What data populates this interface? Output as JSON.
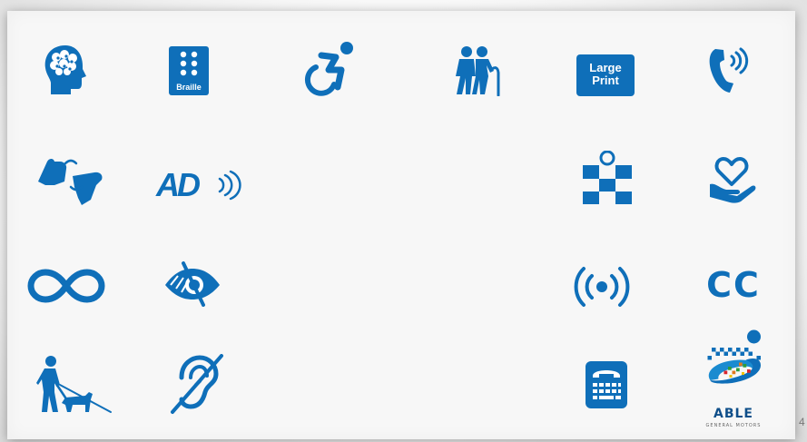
{
  "colors": {
    "icon_blue": "#0f6fb9",
    "panel": "#f7f7f7"
  },
  "icons": [
    {
      "name": "cognitive-disability-brain-icon"
    },
    {
      "name": "braille-icon",
      "label": "Braille"
    },
    {
      "name": "accessible-wheelchair-icon"
    },
    {
      "name": "seniors-with-cane-icon"
    },
    {
      "name": "large-print-icon",
      "label_line1": "Large",
      "label_line2": "Print"
    },
    {
      "name": "volume-control-telephone-icon"
    },
    {
      "name": "sign-language-interpretation-icon"
    },
    {
      "name": "audio-description-icon",
      "label": "AD"
    },
    {
      "name": "accessibility-symbol-checkered-icon"
    },
    {
      "name": "heart-in-hand-icon"
    },
    {
      "name": "infinity-neurodiversity-icon"
    },
    {
      "name": "low-vision-eye-icon"
    },
    {
      "name": "assistive-listening-icon"
    },
    {
      "name": "closed-captioning-icon",
      "label": "CC"
    },
    {
      "name": "blind-person-with-guide-dog-icon"
    },
    {
      "name": "hearing-loss-ear-icon"
    },
    {
      "name": "tty-text-telephone-icon"
    },
    {
      "name": "able-gm-logo-icon",
      "wordmark": "ABLE",
      "subtitle": "GENERAL MOTORS"
    }
  ],
  "large_print": {
    "line1": "Large",
    "line2": "Print"
  },
  "braille": {
    "label": "Braille"
  },
  "audio_description": {
    "label": "AD"
  },
  "closed_caption": {
    "label": "CC"
  },
  "able_logo": {
    "wordmark": "ABLE",
    "subtitle": "GENERAL MOTORS"
  },
  "page_number": "4"
}
